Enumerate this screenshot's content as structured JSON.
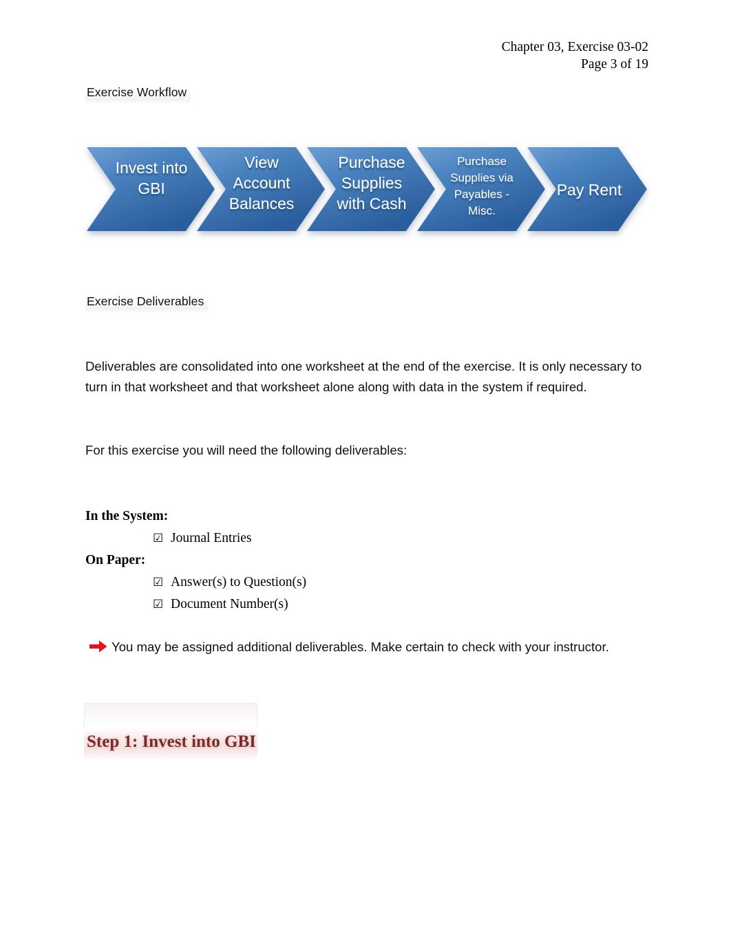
{
  "header": {
    "line1": "Chapter 03, Exercise 03-02",
    "line2": "Page 3 of 19"
  },
  "sections": {
    "workflow_heading": "Exercise Workflow",
    "deliverables_heading": "Exercise Deliverables"
  },
  "workflow": {
    "steps": [
      {
        "id": "invest-into-gbi",
        "lines": [
          "Invest into",
          "GBI"
        ],
        "font_size": 23
      },
      {
        "id": "view-account-balances",
        "lines": [
          "View",
          "Account",
          "Balances"
        ],
        "font_size": 23
      },
      {
        "id": "purchase-supplies-with-cash",
        "lines": [
          "Purchase",
          "Supplies",
          "with Cash"
        ],
        "font_size": 23
      },
      {
        "id": "purchase-supplies-via-payables-misc",
        "lines": [
          "Purchase",
          "Supplies via",
          "Payables -",
          "Misc."
        ],
        "font_size": 17
      },
      {
        "id": "pay-rent",
        "lines": [
          "Pay Rent"
        ],
        "font_size": 23
      }
    ],
    "colors": {
      "blue_light": "#5b8fc9",
      "blue_mid": "#3d78b8",
      "blue_dark": "#2b5f9e",
      "label": "#ffffff"
    }
  },
  "body": {
    "deliverables_paragraph": "Deliverables are consolidated into one worksheet at the end of the exercise. It is only necessary to turn in that worksheet and that worksheet alone along with data in the system if required.",
    "need_paragraph": "For this exercise you will need the following deliverables:"
  },
  "deliverables": {
    "groups": [
      {
        "label": "In the System:",
        "items": [
          {
            "checkbox": "☑",
            "text": "Journal Entries"
          }
        ]
      },
      {
        "label": "On Paper:",
        "items": [
          {
            "checkbox": "☑",
            "text": "Answer(s) to Question(s)"
          },
          {
            "checkbox": "☑",
            "text": "Document Number(s)"
          }
        ]
      }
    ]
  },
  "note": {
    "arrow_glyph": "arrow-right-icon",
    "arrow_color": "#ee1111",
    "text": "You may be assigned additional deliverables. Make certain to check with your instructor."
  },
  "step": {
    "title": "Step 1: Invest into GBI",
    "color": "#7b2a2a"
  }
}
